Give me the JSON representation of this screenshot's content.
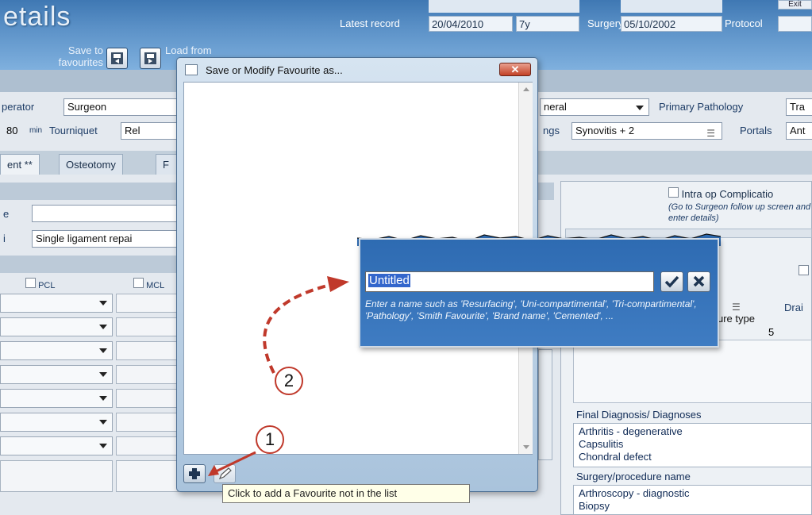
{
  "header": {
    "title": "etails",
    "latest_record_label": "Latest record",
    "latest_record_date": "20/04/2010",
    "latest_record_age": "7y",
    "surgery_label": "Surgery",
    "surgery_date": "05/10/2002",
    "protocol_label": "Protocol",
    "save_to_favourites": "Save to favourites",
    "load_from": "Load from",
    "corner_button": "Exit"
  },
  "form": {
    "operator_label": "perator",
    "operator_value": "Surgeon",
    "anaesthetic_fragment": "neral",
    "primary_pathology_label": "Primary Pathology",
    "primary_pathology_value": "Tra",
    "duration_value": "80",
    "duration_unit": "min",
    "tourniquet_label": "Tourniquet",
    "tourniquet_value": "Rel",
    "findings_label": "ngs",
    "findings_value": "Synovitis + 2",
    "portals_label": "Portals",
    "portals_value": "Ant",
    "tabs": [
      "ent **",
      "Osteotomy",
      "F"
    ],
    "row_label_e": "e",
    "row_label_i": "i",
    "ligament_value": "Single ligament repai",
    "checkbox_pcl": "PCL",
    "checkbox_mcl": "MCL",
    "intra_op_label": "Intra op Complicatio",
    "intra_op_note": "(Go to Surgeon follow up screen and enter details)",
    "drain_label": "Drai",
    "closure_type_label": "ure type",
    "closure_value": "5",
    "final_diagnosis_label": "Final Diagnosis/ Diagnoses",
    "diagnoses": [
      "Arthritis - degenerative",
      "Capsulitis",
      "Chondral defect"
    ],
    "procedure_label": "Surgery/procedure name",
    "procedures": [
      "Arthroscopy - diagnostic",
      "Biopsy"
    ]
  },
  "dialog": {
    "title": "Save or Modify Favourite as...",
    "close_label": "✕",
    "tooltip": "Click to add a Favourite not in the list"
  },
  "popup": {
    "input_value": "Untitled",
    "hint": "Enter a name such as  'Resurfacing', 'Uni-compartimental', 'Tri-compartimental', 'Pathology', 'Smith Favourite',  'Brand name', 'Cemented', ..."
  },
  "markers": {
    "one": "1",
    "two": "2"
  },
  "colors": {
    "header_blue": "#4f86bf",
    "popup_blue": "#3a78c0",
    "arrow_red": "#c0392b"
  }
}
